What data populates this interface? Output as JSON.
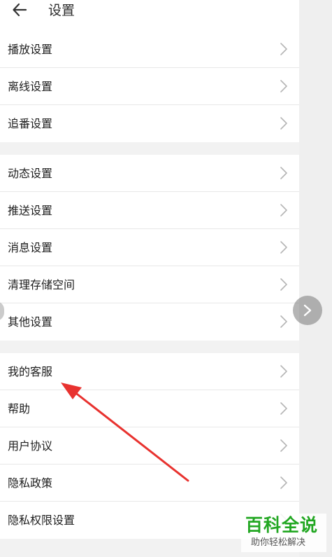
{
  "header": {
    "title": "设置",
    "back_icon": "arrow-left-icon"
  },
  "groups": [
    {
      "items": [
        {
          "label": "播放设置"
        },
        {
          "label": "离线设置"
        },
        {
          "label": "追番设置"
        }
      ]
    },
    {
      "items": [
        {
          "label": "动态设置"
        },
        {
          "label": "推送设置"
        },
        {
          "label": "消息设置"
        },
        {
          "label": "清理存储空间"
        },
        {
          "label": "其他设置"
        }
      ]
    },
    {
      "items": [
        {
          "label": "我的客服"
        },
        {
          "label": "帮助"
        },
        {
          "label": "用户协议"
        },
        {
          "label": "隐私政策"
        },
        {
          "label": "隐私权限设置"
        }
      ]
    }
  ],
  "watermark": {
    "title": "百科全说",
    "subtitle": "助你轻松解决"
  },
  "colors": {
    "annotation_arrow": "#e8322f",
    "watermark_green": "#22a722"
  }
}
